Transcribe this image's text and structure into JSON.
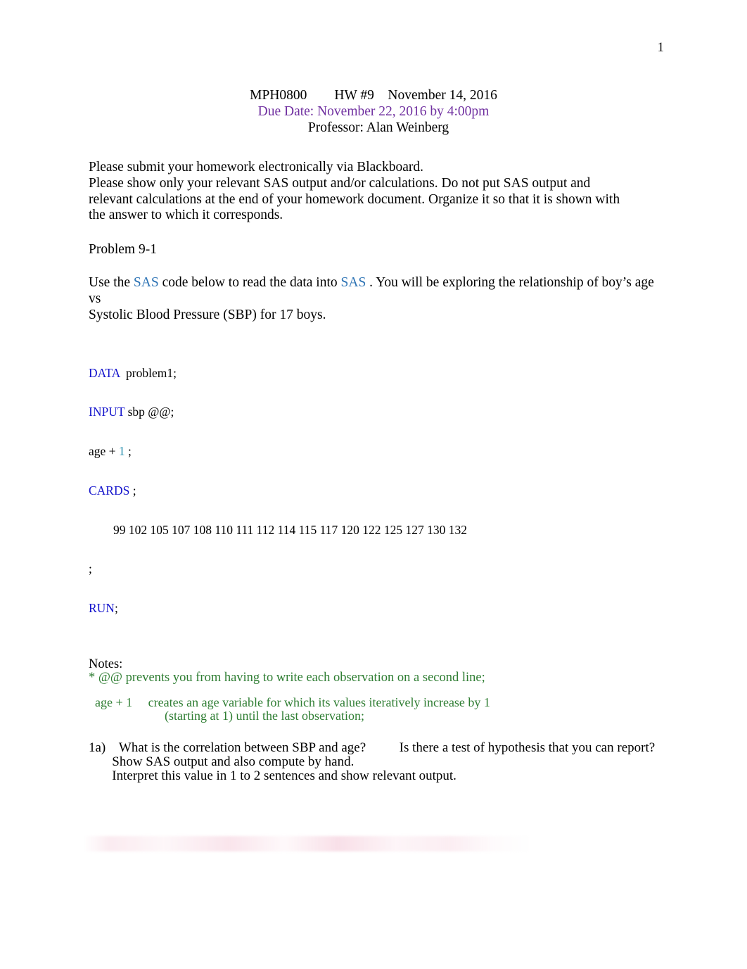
{
  "document": {
    "page_number": "1",
    "colors": {
      "purple": "#7030A0",
      "sas_blue": "#2E74B5",
      "keyword_blue": "#1414CC",
      "numeric_teal": "#2B91AF",
      "note_green": "#2E7D32",
      "text_black": "#000000"
    }
  },
  "header": {
    "line1": "MPH0800        HW #9    November 14, 2016",
    "line2": "Due Date: November 22, 2016 by 4:00pm",
    "line3": "Professor: Alan Weinberg"
  },
  "instructions": {
    "line1": "Please submit your homework electronically via Blackboard.",
    "line2": "Please show only your relevant SAS output and/or calculations. Do not put SAS output and",
    "line3": "relevant calculations at the end of your homework document. Organize it so that it is shown with",
    "line4": "the answer to which it corresponds."
  },
  "problem": {
    "heading": "Problem 9-1",
    "intro": {
      "part1": "Use the ",
      "sas1": "SAS",
      "part2": " code below to read the data into       ",
      "sas2": "SAS",
      "part3": " .    You will be exploring the relationship of boy’s age vs",
      "line2": "Systolic Blood Pressure (SBP) for 17 boys."
    }
  },
  "sas_code": {
    "line1_kw": "DATA",
    "line1_rest": "  problem1;",
    "line2_kw": "INPUT",
    "line2_rest": " sbp @@;",
    "line3_pre": "age + ",
    "line3_num": "1",
    "line3_post": " ;",
    "line4_kw": "CARDS",
    "line4_rest": " ;",
    "data_values": "        99 102 105 107 108 110 111 112 114 115 117 120 122 125 127 130 132",
    "line6": ";",
    "line7_kw": "RUN",
    "line7_rest": ";",
    "data_list": [
      99,
      102,
      105,
      107,
      108,
      110,
      111,
      112,
      114,
      115,
      117,
      120,
      122,
      125,
      127,
      130,
      132
    ],
    "observation_count": 17
  },
  "notes": {
    "label": "Notes:",
    "note1": "* @@ prevents you from having to write each observation on a second line;",
    "note2_term": "  age + 1",
    "note2_desc": "     creates an age variable for which its values iteratively increase by 1",
    "note2_cont": "                        (starting at 1) until the last observation;"
  },
  "questions": {
    "q1a_marker": "1a)",
    "q1a_line1_a": "    What is the correlation between SBP and age?",
    "q1a_line1_b": "          Is there a test of hypothesis that you can report?",
    "q1a_line2": "       Show SAS output and also compute by hand.",
    "q1a_line3": "       Interpret this value in 1 to 2 sentences and show relevant output."
  }
}
